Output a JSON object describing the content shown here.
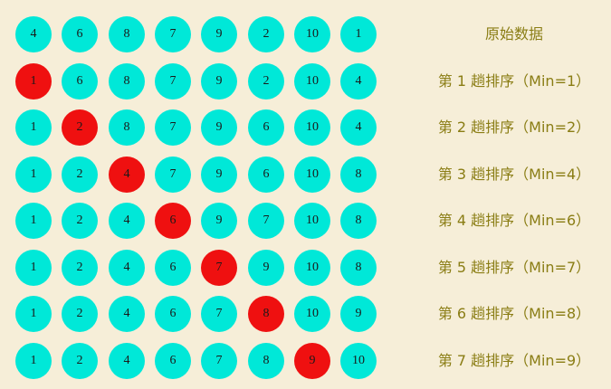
{
  "rows": [
    {
      "label": "原始数据",
      "values": [
        "4",
        "6",
        "8",
        "7",
        "9",
        "2",
        "10",
        "1"
      ],
      "highlight": -1
    },
    {
      "label": "第 1 趟排序（Min=1）",
      "values": [
        "1",
        "6",
        "8",
        "7",
        "9",
        "2",
        "10",
        "4"
      ],
      "highlight": 0
    },
    {
      "label": "第 2 趟排序（Min=2）",
      "values": [
        "1",
        "2",
        "8",
        "7",
        "9",
        "6",
        "10",
        "4"
      ],
      "highlight": 1
    },
    {
      "label": "第 3 趟排序（Min=4）",
      "values": [
        "1",
        "2",
        "4",
        "7",
        "9",
        "6",
        "10",
        "8"
      ],
      "highlight": 2
    },
    {
      "label": "第 4 趟排序（Min=6）",
      "values": [
        "1",
        "2",
        "4",
        "6",
        "9",
        "7",
        "10",
        "8"
      ],
      "highlight": 3
    },
    {
      "label": "第 5 趟排序（Min=7）",
      "values": [
        "1",
        "2",
        "4",
        "6",
        "7",
        "9",
        "10",
        "8"
      ],
      "highlight": 4
    },
    {
      "label": "第 6 趟排序（Min=8）",
      "values": [
        "1",
        "2",
        "4",
        "6",
        "7",
        "8",
        "10",
        "9"
      ],
      "highlight": 5
    },
    {
      "label": "第 7 趟排序（Min=9）",
      "values": [
        "1",
        "2",
        "4",
        "6",
        "7",
        "8",
        "9",
        "10"
      ],
      "highlight": 6
    }
  ],
  "colors": {
    "ball": "#00e8d8",
    "min_ball": "#ef1010",
    "label_text": "#8a7d14",
    "background": "#f6eed8"
  }
}
